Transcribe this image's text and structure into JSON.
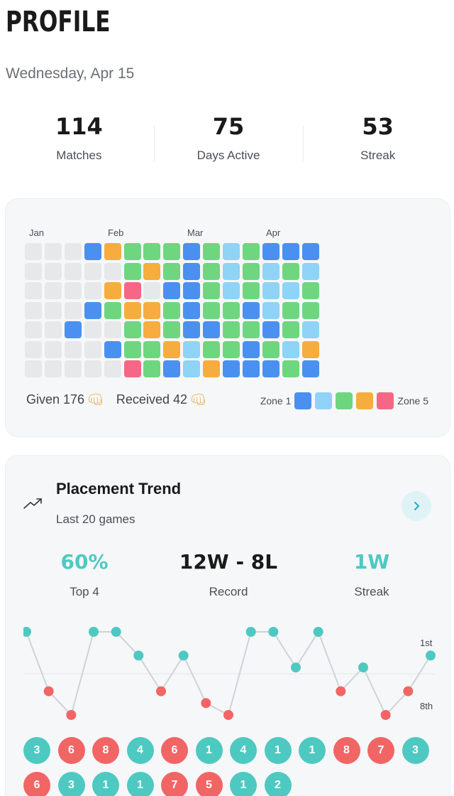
{
  "page": {
    "title": "PROFILE",
    "date": "Wednesday, Apr 15"
  },
  "stats": [
    {
      "value": "114",
      "label": "Matches"
    },
    {
      "value": "75",
      "label": "Days Active"
    },
    {
      "value": "53",
      "label": "Streak"
    }
  ],
  "colors": {
    "empty": "#e6e8ea",
    "zone1": "#4a90f0",
    "zone2": "#8fd3f7",
    "zone3": "#6fd680",
    "zone4": "#f6ad3e",
    "zone5": "#f56784",
    "teal": "#4ec9c2",
    "red": "#f26565"
  },
  "heatmap": {
    "months": [
      "Jan",
      "Feb",
      "Mar",
      "Apr"
    ],
    "rows": [
      [
        0,
        0,
        0,
        1,
        4,
        3,
        3,
        3,
        1,
        3,
        2,
        3,
        1,
        1,
        1
      ],
      [
        0,
        0,
        0,
        0,
        0,
        3,
        4,
        3,
        1,
        3,
        2,
        3,
        2,
        3,
        2
      ],
      [
        0,
        0,
        0,
        0,
        4,
        5,
        0,
        1,
        1,
        3,
        2,
        3,
        2,
        2,
        3
      ],
      [
        0,
        0,
        0,
        1,
        3,
        4,
        4,
        3,
        1,
        3,
        3,
        1,
        2,
        3,
        3
      ],
      [
        0,
        0,
        1,
        0,
        0,
        3,
        4,
        3,
        1,
        1,
        3,
        3,
        1,
        3,
        2
      ],
      [
        0,
        0,
        0,
        0,
        1,
        3,
        3,
        4,
        2,
        3,
        3,
        1,
        3,
        2,
        4
      ],
      [
        0,
        0,
        0,
        0,
        0,
        5,
        3,
        1,
        2,
        4,
        1,
        1,
        1,
        3,
        1
      ]
    ],
    "given_label": "Given 176",
    "received_label": "Received 42",
    "fist_icon": "oncoming-fist-icon",
    "legend_start": "Zone 1",
    "legend_end": "Zone 5"
  },
  "trend": {
    "title": "Placement Trend",
    "subtitle": "Last 20 games",
    "icon": "trending-up-icon",
    "button_icon": "chevron-right-icon",
    "top4_value": "60%",
    "top4_label": "Top 4",
    "record_value": "12W - 8L",
    "record_label": "Record",
    "streak_value": "1W",
    "streak_label": "Streak"
  },
  "chart_data": {
    "type": "line",
    "x": [
      1,
      2,
      3,
      4,
      5,
      6,
      7,
      8,
      9,
      10,
      11,
      12,
      13,
      14,
      15,
      16,
      17,
      18,
      19,
      20
    ],
    "y_axis_labels": {
      "top": "1st",
      "bottom": "8th"
    },
    "series": [
      {
        "values": [
          1,
          6,
          8,
          1,
          1,
          3,
          6,
          3,
          7,
          8,
          1,
          1,
          4,
          1,
          6,
          4,
          8,
          6,
          3
        ]
      }
    ],
    "ylim": [
      1,
      8
    ],
    "y_inverted": true,
    "note_placements": [
      3,
      6,
      8,
      4,
      6,
      1,
      4,
      1,
      1,
      8,
      7,
      3,
      6,
      3,
      1,
      1,
      7,
      5,
      1,
      2
    ]
  },
  "placements": [
    3,
    6,
    8,
    4,
    6,
    1,
    4,
    1,
    1,
    8,
    7,
    3,
    6,
    3,
    1,
    1,
    7,
    5,
    1,
    2
  ]
}
